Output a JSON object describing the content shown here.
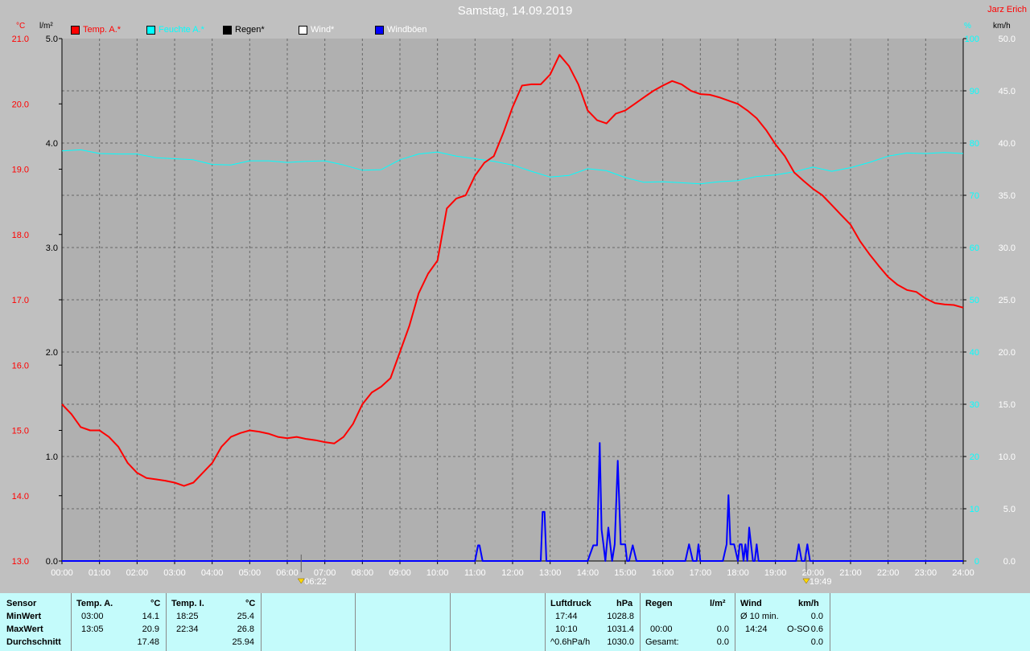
{
  "title": "Samstag, 14.09.2019",
  "author": "Jarz Erich",
  "units": {
    "left_temp": "°C",
    "left_rain": "l/m²",
    "right_pct": "%",
    "right_wind": "km/h"
  },
  "legend": [
    {
      "label": "Temp. A.*",
      "color": "#ff0000"
    },
    {
      "label": "Feuchte A.*",
      "color": "#00ffff"
    },
    {
      "label": "Regen*",
      "color": "#000000"
    },
    {
      "label": "Wind*",
      "color": "#ffffff"
    },
    {
      "label": "Windböen",
      "color": "#0000ff"
    }
  ],
  "chart_data": {
    "type": "line",
    "x_ticks": [
      "00:00",
      "01:00",
      "02:00",
      "03:00",
      "04:00",
      "05:00",
      "06:00",
      "07:00",
      "08:00",
      "09:00",
      "10:00",
      "11:00",
      "12:00",
      "13:00",
      "14:00",
      "15:00",
      "16:00",
      "17:00",
      "18:00",
      "19:00",
      "20:00",
      "21:00",
      "22:00",
      "23:00",
      "24:00"
    ],
    "axis_temp": {
      "ticks": [
        "13.0",
        "14.0",
        "15.0",
        "16.0",
        "17.0",
        "18.0",
        "19.0",
        "20.0",
        "21.0"
      ],
      "ylim": [
        13,
        21
      ],
      "color": "#ff0000"
    },
    "axis_rain": {
      "ticks": [
        "0.0",
        "1.0",
        "2.0",
        "3.0",
        "4.0",
        "5.0"
      ],
      "ylim": [
        0,
        5
      ]
    },
    "axis_humidity": {
      "ticks": [
        "0",
        "10",
        "20",
        "30",
        "40",
        "50",
        "60",
        "70",
        "80",
        "90",
        "100"
      ],
      "ylim": [
        0,
        100
      ],
      "color": "#00ffff"
    },
    "axis_wind": {
      "ticks": [
        "0.0",
        "5.0",
        "10.0",
        "15.0",
        "20.0",
        "25.0",
        "30.0",
        "35.0",
        "40.0",
        "45.0",
        "50.0"
      ],
      "ylim": [
        0,
        50
      ]
    },
    "grid": true,
    "sun_markers": [
      {
        "label": "06:22",
        "hour": 6.37
      },
      {
        "label": "19:49",
        "hour": 19.82
      }
    ],
    "series": [
      {
        "name": "Temp. A.*",
        "color": "#ff0000",
        "axis": "temp",
        "x": [
          0,
          0.25,
          0.5,
          0.75,
          1,
          1.25,
          1.5,
          1.75,
          2,
          2.25,
          2.5,
          2.75,
          3,
          3.25,
          3.5,
          3.75,
          4,
          4.25,
          4.5,
          4.75,
          5,
          5.25,
          5.5,
          5.75,
          6,
          6.25,
          6.5,
          6.75,
          7,
          7.25,
          7.5,
          7.75,
          8,
          8.25,
          8.5,
          8.75,
          9,
          9.25,
          9.5,
          9.75,
          10,
          10.25,
          10.5,
          10.75,
          11,
          11.25,
          11.5,
          11.75,
          12,
          12.25,
          12.5,
          12.75,
          13,
          13.25,
          13.5,
          13.75,
          14,
          14.25,
          14.5,
          14.75,
          15,
          15.25,
          15.5,
          15.75,
          16,
          16.25,
          16.5,
          16.75,
          17,
          17.25,
          17.5,
          17.75,
          18,
          18.25,
          18.5,
          18.75,
          19,
          19.25,
          19.5,
          19.75,
          20,
          20.25,
          20.5,
          20.75,
          21,
          21.25,
          21.5,
          21.75,
          22,
          22.25,
          22.5,
          22.75,
          23,
          23.25,
          23.5,
          23.75,
          24
        ],
        "y": [
          15.4,
          15.25,
          15.05,
          15.0,
          15.0,
          14.9,
          14.75,
          14.5,
          14.35,
          14.27,
          14.25,
          14.23,
          14.2,
          14.15,
          14.2,
          14.35,
          14.5,
          14.75,
          14.9,
          14.96,
          15.0,
          14.98,
          14.95,
          14.9,
          14.88,
          14.9,
          14.87,
          14.85,
          14.82,
          14.8,
          14.9,
          15.1,
          15.4,
          15.58,
          15.67,
          15.8,
          16.2,
          16.6,
          17.1,
          17.4,
          17.6,
          18.4,
          18.55,
          18.6,
          18.9,
          19.1,
          19.2,
          19.55,
          19.95,
          20.28,
          20.3,
          20.3,
          20.45,
          20.75,
          20.58,
          20.3,
          19.9,
          19.75,
          19.7,
          19.85,
          19.9,
          20.0,
          20.1,
          20.2,
          20.28,
          20.35,
          20.3,
          20.2,
          20.15,
          20.14,
          20.1,
          20.05,
          20.0,
          19.9,
          19.78,
          19.6,
          19.38,
          19.2,
          18.95,
          18.82,
          18.7,
          18.6,
          18.45,
          18.3,
          18.15,
          17.9,
          17.7,
          17.52,
          17.35,
          17.23,
          17.15,
          17.12,
          17.02,
          16.95,
          16.93,
          16.92,
          16.88
        ]
      },
      {
        "name": "Feuchte A.*",
        "color": "#00ffff",
        "axis": "humidity",
        "x": [
          0,
          0.5,
          1,
          1.5,
          2,
          2.5,
          3,
          3.5,
          4,
          4.5,
          5,
          5.5,
          6,
          6.5,
          7,
          7.5,
          8,
          8.5,
          9,
          9.5,
          10,
          10.5,
          11,
          11.5,
          12,
          12.5,
          13,
          13.5,
          14,
          14.5,
          15,
          15.5,
          16,
          16.5,
          17,
          17.5,
          18,
          18.5,
          19,
          19.5,
          20,
          20.5,
          21,
          21.5,
          22,
          22.5,
          23,
          23.5,
          24
        ],
        "y": [
          78.5,
          78.7,
          78,
          77.9,
          77.9,
          77.2,
          77,
          76.8,
          75.9,
          75.8,
          76.6,
          76.6,
          76.3,
          76.5,
          76.6,
          75.8,
          74.8,
          74.9,
          76.8,
          77.9,
          78.3,
          77.5,
          77,
          76.5,
          75.8,
          74.6,
          73.5,
          73.8,
          75.1,
          74.7,
          73.4,
          72.5,
          72.6,
          72.4,
          72.2,
          72.6,
          72.8,
          73.6,
          73.9,
          74.5,
          75.4,
          74.6,
          75.3,
          76.3,
          77.5,
          78.1,
          78,
          78.2,
          78
        ]
      },
      {
        "name": "Windböen",
        "color": "#0000ff",
        "axis": "wind",
        "x": [
          0,
          11.0,
          11.08,
          11.12,
          11.2,
          12.0,
          12.75,
          12.8,
          12.85,
          12.9,
          13.0,
          14.0,
          14.15,
          14.25,
          14.32,
          14.37,
          14.42,
          14.47,
          14.55,
          14.65,
          14.72,
          14.8,
          14.88,
          14.95,
          15.0,
          15.05,
          15.1,
          15.2,
          15.3,
          15.35,
          15.4,
          15.5,
          16.0,
          16.6,
          16.7,
          16.8,
          16.9,
          16.95,
          17.0,
          17.6,
          17.7,
          17.75,
          17.8,
          17.85,
          17.9,
          18.0,
          18.05,
          18.1,
          18.15,
          18.2,
          18.25,
          18.3,
          18.35,
          18.4,
          18.45,
          18.5,
          18.55,
          18.6,
          18.65,
          18.7,
          18.75,
          18.8,
          19.0,
          19.55,
          19.62,
          19.7,
          19.78,
          19.85,
          19.92,
          20.0,
          20.1,
          24
        ],
        "y": [
          0,
          0,
          1.5,
          1.5,
          0,
          0,
          0,
          4.7,
          4.7,
          0,
          0,
          0,
          1.5,
          1.5,
          11.3,
          3,
          1.6,
          0,
          3.2,
          0,
          1.6,
          9.6,
          1.6,
          1.6,
          1.6,
          0,
          0,
          1.5,
          0,
          0,
          0,
          0,
          0,
          0,
          1.6,
          0,
          0,
          1.6,
          0,
          0,
          1.6,
          6.3,
          1.6,
          1.6,
          1.6,
          0,
          1.6,
          1.6,
          0,
          1.6,
          0,
          3.2,
          1.6,
          0,
          0,
          1.6,
          0,
          0,
          0,
          0,
          0,
          0,
          0,
          0,
          1.6,
          0,
          0,
          1.6,
          0,
          0,
          0,
          0
        ]
      }
    ]
  },
  "stats": {
    "headers": {
      "sensor": "Sensor",
      "temp_a": "Temp. A.",
      "temp_a_unit": "°C",
      "temp_i": "Temp. I.",
      "temp_i_unit": "°C",
      "pressure": "Luftdruck",
      "pressure_unit": "hPa",
      "rain": "Regen",
      "rain_unit": "l/m²",
      "wind": "Wind",
      "wind_unit": "km/h"
    },
    "rows": {
      "min": "MinWert",
      "max": "MaxWert",
      "avg": "Durchschnitt"
    },
    "temp_a": {
      "min_time": "03:00",
      "min": "14.1",
      "max_time": "13:05",
      "max": "20.9",
      "avg": "17.48"
    },
    "temp_i": {
      "min_time": "18:25",
      "min": "25.4",
      "max_time": "22:34",
      "max": "26.8",
      "avg": "25.94"
    },
    "pressure": {
      "min_time": "17:44",
      "min": "1028.8",
      "max_time": "10:10",
      "max": "1031.4",
      "trend_label": "^0.6hPa/h",
      "avg": "1030.0"
    },
    "rain": {
      "max_time": "00:00",
      "max": "0.0",
      "total_label": "Gesamt:",
      "total": "0.0"
    },
    "wind": {
      "avg10_label": "Ø 10 min.",
      "avg10": "0.0",
      "max_time": "14:24",
      "max_dir": "O-SO",
      "max": "0.6",
      "avg": "0.0"
    }
  }
}
